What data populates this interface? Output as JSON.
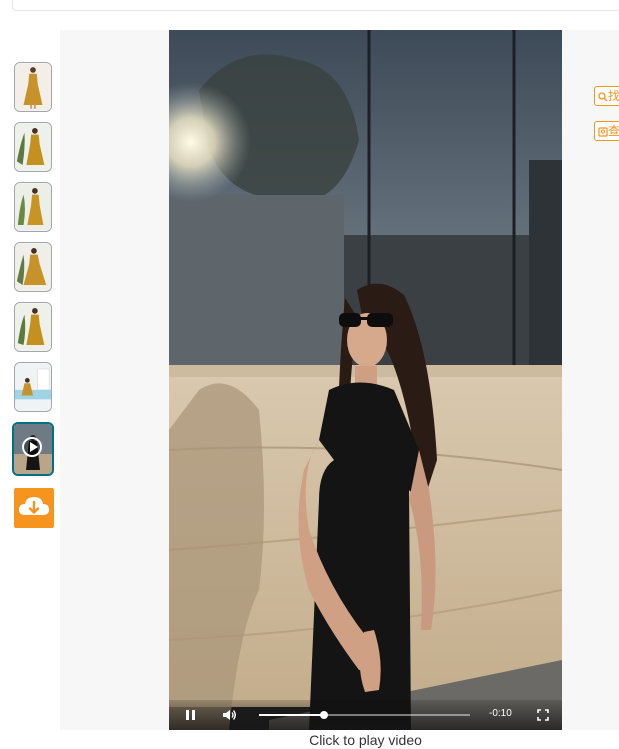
{
  "thumbnails": [
    {
      "name": "mustard-dress-front",
      "kind": "image"
    },
    {
      "name": "mustard-dress-plant",
      "kind": "image"
    },
    {
      "name": "mustard-dress-side",
      "kind": "image"
    },
    {
      "name": "mustard-dress-pose",
      "kind": "image"
    },
    {
      "name": "mustard-dress-walk",
      "kind": "image"
    },
    {
      "name": "mustard-dress-pool",
      "kind": "image"
    },
    {
      "name": "video-thumbnail",
      "kind": "video",
      "selected": true
    }
  ],
  "download_icon": "cloud-download-icon",
  "video": {
    "time_remaining": "-0:10",
    "progress": 0.31,
    "caption": "Click to play video",
    "state": "playing"
  },
  "side_buttons": [
    {
      "icon": "search-icon",
      "label": "找"
    },
    {
      "icon": "image-search-icon",
      "label": "查"
    }
  ],
  "colors": {
    "accent": "#f7941d",
    "selected_border": "#007185",
    "stage_bg": "#f7f7f7"
  }
}
